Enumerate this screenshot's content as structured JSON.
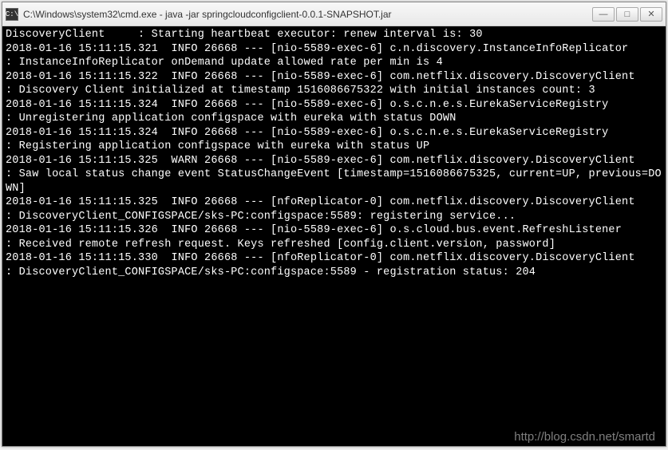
{
  "window": {
    "title": "C:\\Windows\\system32\\cmd.exe - java  -jar springcloudconfigclient-0.0.1-SNAPSHOT.jar",
    "icon_char": "C:\\"
  },
  "controls": {
    "minimize": "—",
    "maximize": "□",
    "close": "✕"
  },
  "log_lines": [
    "DiscoveryClient     : Starting heartbeat executor: renew interval is: 30",
    "2018-01-16 15:11:15.321  INFO 26668 --- [nio-5589-exec-6] c.n.discovery.InstanceInfoReplicator     : InstanceInfoReplicator onDemand update allowed rate per min is 4",
    "2018-01-16 15:11:15.322  INFO 26668 --- [nio-5589-exec-6] com.netflix.discovery.DiscoveryClient     : Discovery Client initialized at timestamp 1516086675322 with initial instances count: 3",
    "2018-01-16 15:11:15.324  INFO 26668 --- [nio-5589-exec-6] o.s.c.n.e.s.EurekaServiceRegistry        : Unregistering application configspace with eureka with status DOWN",
    "2018-01-16 15:11:15.324  INFO 26668 --- [nio-5589-exec-6] o.s.c.n.e.s.EurekaServiceRegistry        : Registering application configspace with eureka with status UP",
    "2018-01-16 15:11:15.325  WARN 26668 --- [nio-5589-exec-6] com.netflix.discovery.DiscoveryClient     : Saw local status change event StatusChangeEvent [timestamp=1516086675325, current=UP, previous=DOWN]",
    "2018-01-16 15:11:15.325  INFO 26668 --- [nfoReplicator-0] com.netflix.discovery.DiscoveryClient     : DiscoveryClient_CONFIGSPACE/sks-PC:configspace:5589: registering service...",
    "2018-01-16 15:11:15.326  INFO 26668 --- [nio-5589-exec-6] o.s.cloud.bus.event.RefreshListener      : Received remote refresh request. Keys refreshed [config.client.version, password]",
    "2018-01-16 15:11:15.330  INFO 26668 --- [nfoReplicator-0] com.netflix.discovery.DiscoveryClient     : DiscoveryClient_CONFIGSPACE/sks-PC:configspace:5589 - registration status: 204"
  ],
  "watermark": "http://blog.csdn.net/smartd"
}
